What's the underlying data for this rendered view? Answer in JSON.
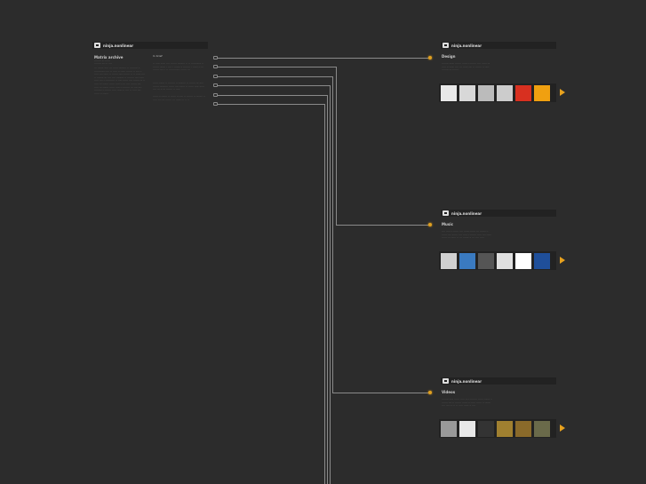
{
  "logo_text": "ninja.nonlinear",
  "left_panel": {
    "title": "Matrix archive",
    "sub1": "········ ··· ······",
    "sub2": "········ ···· ·· ····",
    "body": "··· ······· ····· ··· ······ ········· ·· ········· ·· ············· ···· ·· ····· ·· ······ ······· ·· ···· ·· ····· ···· ······ ·· ······· ····· ······· ·· ·· ······ ···· ·· ········ ··· ···· ···· ········· ·· ········ ···· ······ ····· ···· ·· ·········· ·· ····· ······ ···· ······· ··· ·· ····· ··· ······· ······ ····· ·· ··· ···· ······· ···· ····· ··· ······· ······ ····· ·· ········ ··· ···· ···· ········· ·· ······· ····· ······ ·· ···· ·· ····· ···· ······ ·· ·······",
    "col2_title": "In brief",
    "col2_body": "·· ····· ······ ···· ······· ········· ·· ·· ············ ·· ······· ······· · ···· · ······· ·· ········ · ······ ·· ··· ······· ····· · ·· ············ · ······ ···",
    "col2_body2": "······ ······· ·· ········ ·· ········· ·· ······· ··· ····· ······· ·········· ······ ···· ······· ·· ······ ····· ······ ···· ··· ·· ··· ······· ·· ·····",
    "col2_body3": "······ ·· ······· ·· ······ ·· ····· ·· ······· ·· ········ ·· ····· ··· ···· ······· ··· ······· ·· ·· ··"
  },
  "sections": [
    {
      "title": "Design",
      "body": "········ ······ ······· ······ ·· ······· ···· ······ ··· ····· ·· ······ ···· ··· ······ ···· ·· ······· ·· ····· ········ ··· ·······",
      "thumb_colors": [
        "#e8e8e8",
        "#d8d8d8",
        "#bbbbbb",
        "#cccccc",
        "#d83020",
        "#f0a010"
      ]
    },
    {
      "title": "Music",
      "body": "···· ····· ·· ······ ···· ······· ······ ··· ······· ·· ······ ···· ······· ···· ····· ·· ······· ····· ···· ······ ······ ··· ······ ·· ··· ······· ·· ··· ···· ·····",
      "thumb_colors": [
        "#d0d0d0",
        "#3a7ac0",
        "#555555",
        "#e0e0e0",
        "#ffffff",
        "#1f4f9a"
      ]
    },
    {
      "title": "Videos",
      "body": "········ ····· ······ ····· ·· ·· ········ ······ ······· ·· ······· ···· ·· ······· ······ ··· ····· ······ ·· ······· ···· ···· ··· ·· ·· ····· ······ ·· ····",
      "thumb_colors": [
        "#999999",
        "#e8e8e8",
        "#333333",
        "#a08030",
        "#8a6a2a",
        "#6a6a4a"
      ]
    }
  ],
  "colors": {
    "background": "#2c2c2c",
    "accent": "#e8a21e",
    "line": "#8a8a8a"
  },
  "icons": {
    "arrow": "play-arrow-icon",
    "dot": "node-dot-icon",
    "logo": "ninja-logo-icon"
  }
}
